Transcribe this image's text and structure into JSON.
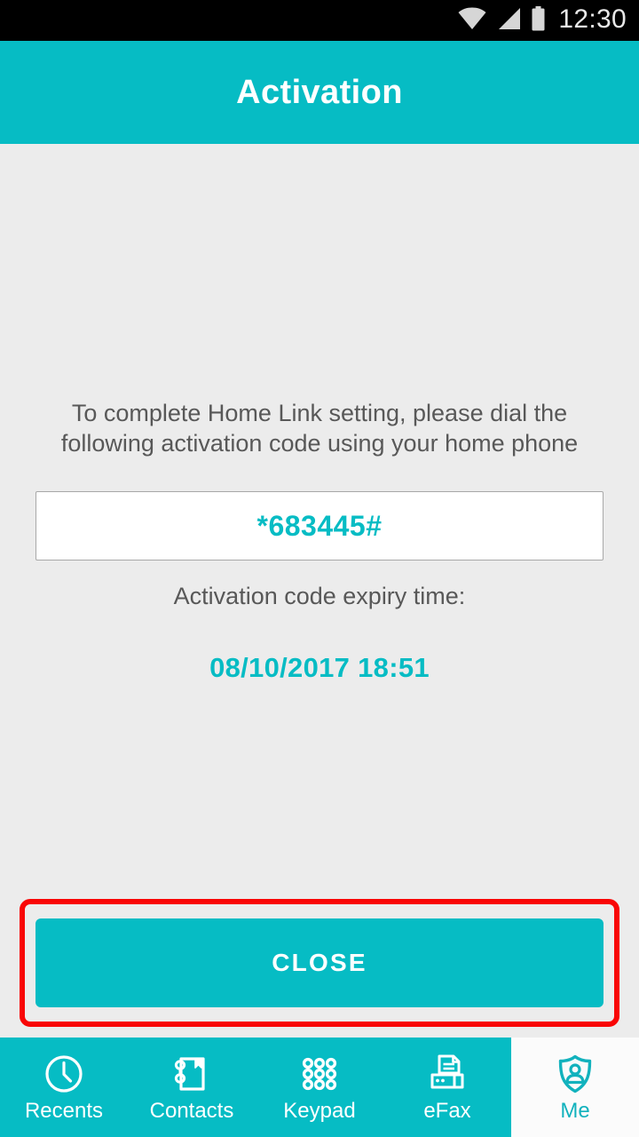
{
  "status_bar": {
    "time": "12:30",
    "icons": [
      "wifi-icon",
      "cellular-signal-icon",
      "battery-icon"
    ]
  },
  "app_bar": {
    "title": "Activation"
  },
  "content": {
    "instruction": "To complete Home Link setting, please dial the following activation code using your home phone",
    "activation_code": "*683445#",
    "expiry_label": "Activation code expiry time:",
    "expiry_value": "08/10/2017 18:51"
  },
  "actions": {
    "close_label": "CLOSE"
  },
  "bottom_nav": {
    "items": [
      {
        "label": "Recents",
        "icon": "clock-icon",
        "active": false
      },
      {
        "label": "Contacts",
        "icon": "address-book-icon",
        "active": false
      },
      {
        "label": "Keypad",
        "icon": "dialpad-icon",
        "active": false
      },
      {
        "label": "eFax",
        "icon": "fax-printer-icon",
        "active": false
      },
      {
        "label": "Me",
        "icon": "shield-person-icon",
        "active": true
      }
    ]
  },
  "colors": {
    "brand_teal": "#06bcc4",
    "annotation_red": "#f90606",
    "content_background": "#ececec",
    "status_bar_background": "#000000",
    "active_tab_background": "#fbfbfb",
    "active_tab_text": "#12b2bd",
    "body_text": "#585858"
  }
}
